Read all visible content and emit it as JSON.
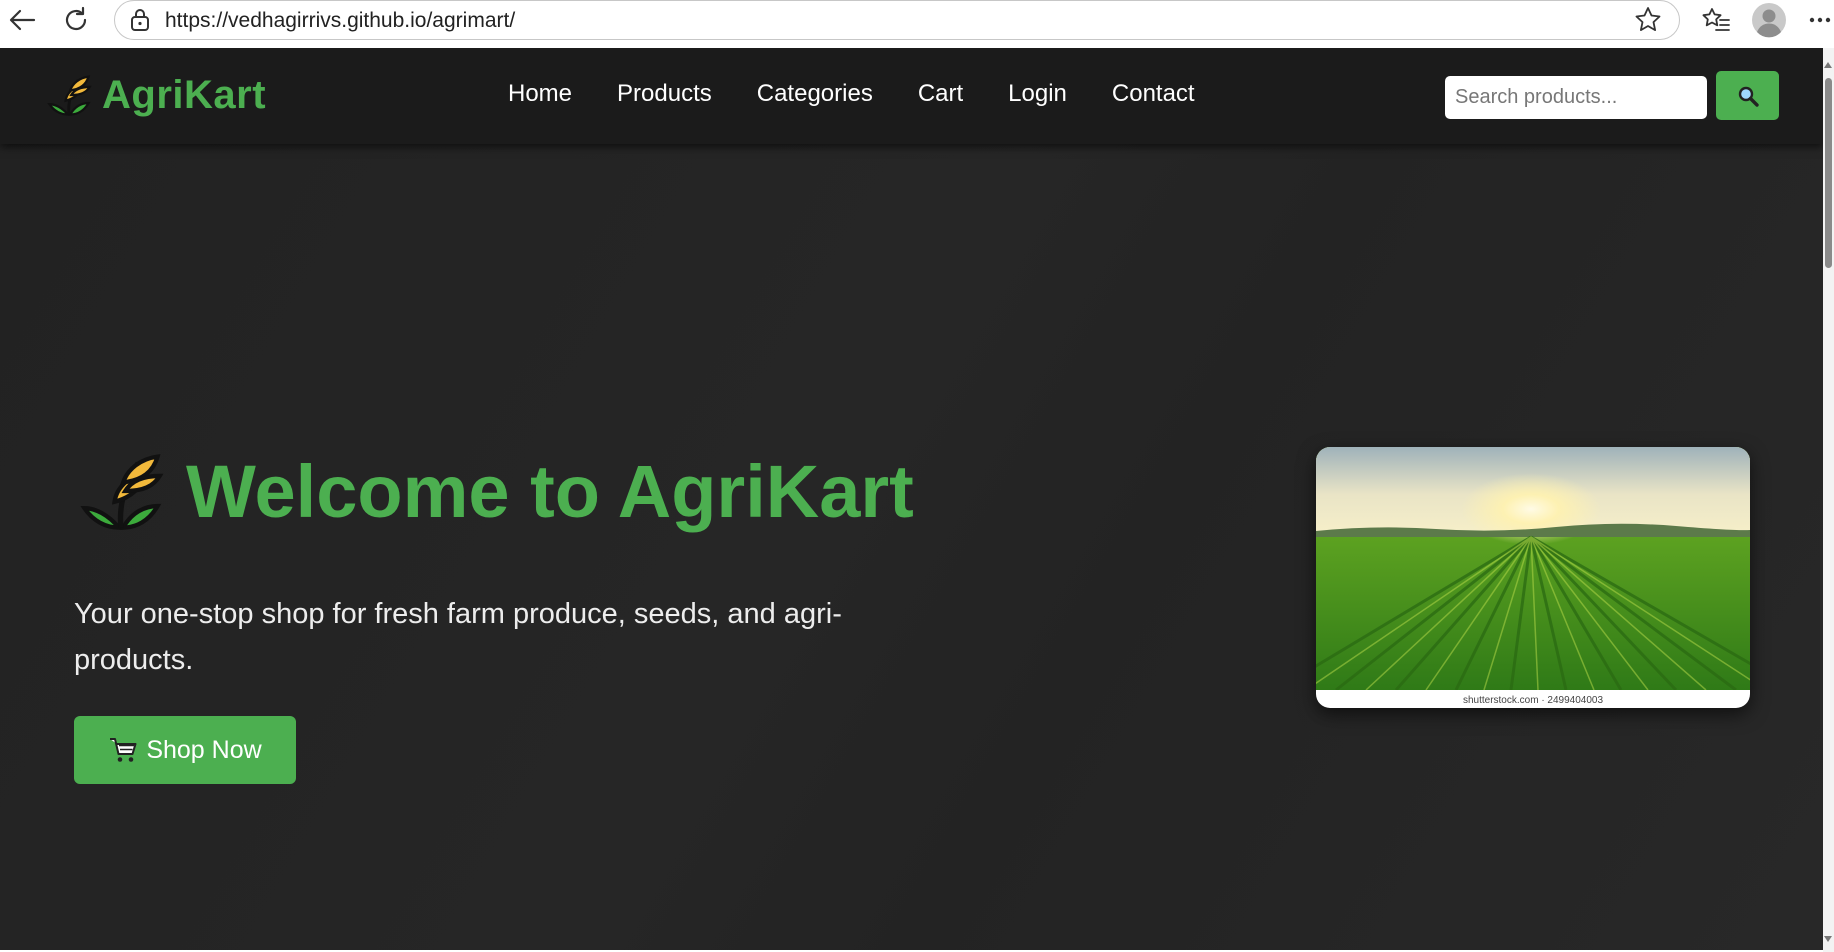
{
  "browser": {
    "url": "https://vedhagirrivs.github.io/agrimart/"
  },
  "nav": {
    "brand": "AgriKart",
    "links": [
      "Home",
      "Products",
      "Categories",
      "Cart",
      "Login",
      "Contact"
    ],
    "search_placeholder": "Search products..."
  },
  "hero": {
    "title": "Welcome to AgriKart",
    "subtitle": "Your one-stop shop for fresh farm produce, seeds, and agri-products.",
    "button_label": "Shop Now",
    "image_caption": "shutterstock.com · 2499404003"
  },
  "colors": {
    "brand_green": "#4caf50",
    "page_background": "#242424",
    "nav_background": "#1b1b1b"
  },
  "icons": {
    "brand_logo": "wheat-sprout-icon",
    "search": "magnifier-icon",
    "shop": "cart-icon"
  }
}
